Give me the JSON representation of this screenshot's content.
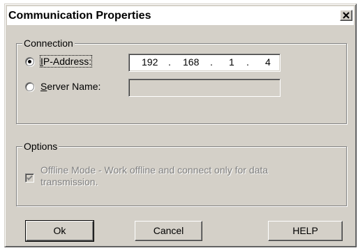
{
  "dialog": {
    "title": "Communication Properties",
    "close_symbol": "×"
  },
  "connection": {
    "legend": "Connection",
    "ip_label_mnemonic": "I",
    "ip_label_rest": "P-Address:",
    "ip_octets": [
      "192",
      "168",
      "1",
      "4"
    ],
    "ip_separator": ".",
    "server_label_mnemonic": "S",
    "server_label_rest": "erver Name:",
    "server_value": "",
    "selected": "ip-address"
  },
  "options": {
    "legend": "Options",
    "offline_line1": "Offline Mode - Work offline and connect only for data",
    "offline_line2": "transmission.",
    "offline_checked": true,
    "offline_enabled": false
  },
  "buttons": {
    "ok": "Ok",
    "cancel": "Cancel",
    "help": "HELP"
  },
  "colors": {
    "dialog_face": "#d4d0c8",
    "disabled_text": "#808080"
  }
}
